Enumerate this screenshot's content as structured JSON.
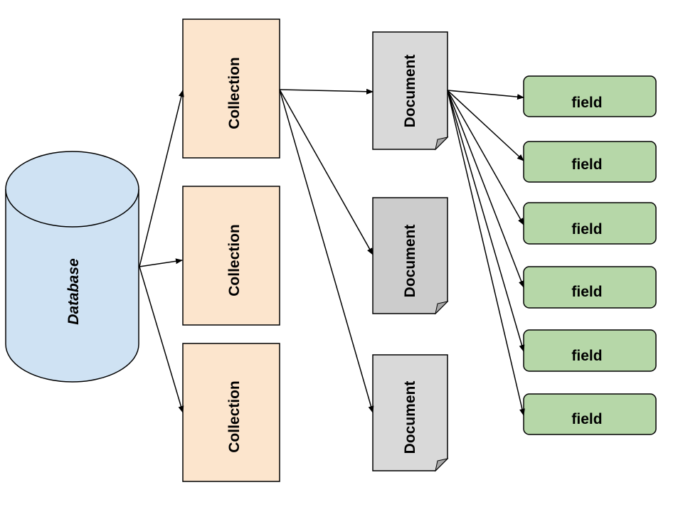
{
  "database": {
    "label": "Database",
    "color": "#cfe2f3"
  },
  "collections": [
    {
      "label": "Collection"
    },
    {
      "label": "Collection"
    },
    {
      "label": "Collection"
    }
  ],
  "collection_color": "#fce5cd",
  "documents": [
    {
      "label": "Document",
      "color": "#d9d9d9"
    },
    {
      "label": "Document",
      "color": "#cccccc"
    },
    {
      "label": "Document",
      "color": "#d9d9d9"
    }
  ],
  "fields": [
    {
      "label": "field"
    },
    {
      "label": "field"
    },
    {
      "label": "field"
    },
    {
      "label": "field"
    },
    {
      "label": "field"
    },
    {
      "label": "field"
    }
  ],
  "field_color": "#b6d7a8"
}
